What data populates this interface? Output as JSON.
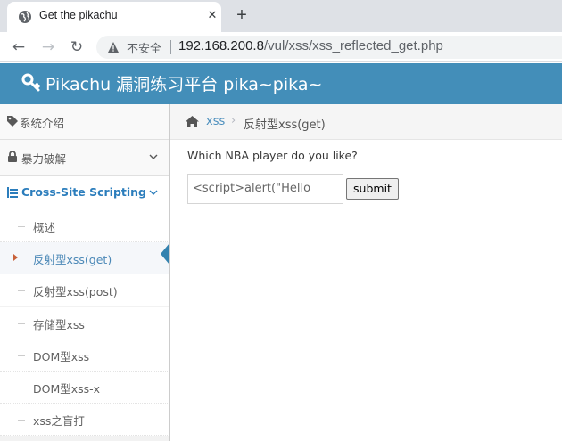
{
  "browser": {
    "tab_title": "Get the pikachu",
    "close_glyph": "✕",
    "new_tab_glyph": "+",
    "back_glyph": "←",
    "forward_glyph": "→",
    "reload_glyph": "↻",
    "security_text": "不安全",
    "url_host": "192.168.200.8",
    "url_path": "/vul/xss/xss_reflected_get.php"
  },
  "site": {
    "title": "Pikachu 漏洞练习平台 pika~pika~",
    "accent_color": "#438eb9"
  },
  "sidebar": {
    "items": [
      {
        "label": "系统介绍",
        "icon": "tag-icon"
      },
      {
        "label": "暴力破解",
        "icon": "lock-icon"
      },
      {
        "label": "Cross-Site Scripting",
        "icon": "list-icon"
      }
    ],
    "sub_items": [
      {
        "label": "概述"
      },
      {
        "label": "反射型xss(get)"
      },
      {
        "label": "反射型xss(post)"
      },
      {
        "label": "存储型xss"
      },
      {
        "label": "DOM型xss"
      },
      {
        "label": "DOM型xss-x"
      },
      {
        "label": "xss之盲打"
      }
    ]
  },
  "breadcrumb": {
    "link": "xss",
    "separator": "›",
    "current": "反射型xss(get)"
  },
  "form": {
    "question": "Which NBA player do you like?",
    "input_value": "<script>alert(\"Hello",
    "submit_label": "submit"
  }
}
